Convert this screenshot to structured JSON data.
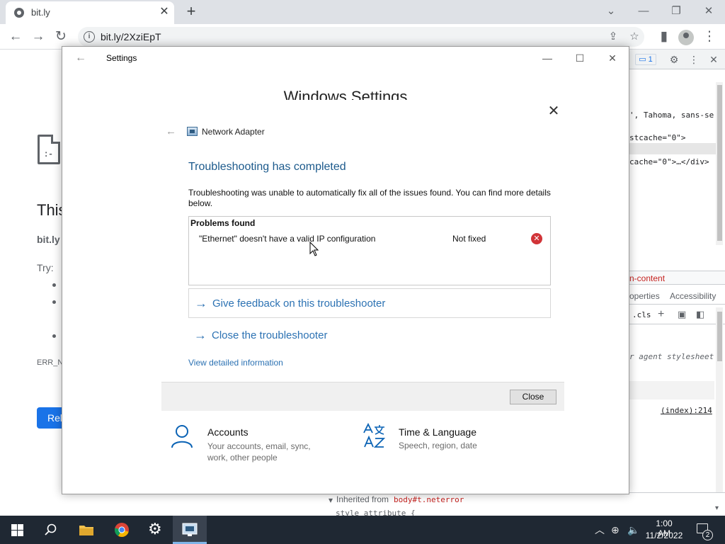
{
  "browser": {
    "tab_title": "bit.ly",
    "url": "bit.ly/2XziEpT",
    "icons": [
      "globe-icon",
      "close-icon",
      "plus-icon",
      "back-icon",
      "forward-icon",
      "reload-icon",
      "info-icon",
      "share-icon",
      "star-icon",
      "sidepanel-icon",
      "profile-icon",
      "menu-icon"
    ]
  },
  "error_page": {
    "title_partial": "This",
    "host_partial": "bit.ly",
    "try_label": "Try:",
    "code_partial": "ERR_NA",
    "reload_partial": "Rel"
  },
  "devtools": {
    "issues_count": "1",
    "code_line_1": "', Tahoma, sans-se",
    "code_line_2": "stcache=\"0\">",
    "code_line_3": "cache=\"0\">…</div>",
    "crumb": "n-content",
    "subtab_properties": "operties",
    "subtab_accessibility": "Accessibility",
    "filter_cls": ".cls",
    "ua_stylesheet": "r agent stylesheet",
    "source_link": "(index):214",
    "inherited_label": "Inherited from",
    "inherited_selector": "body#t.neterror",
    "style_attr": "style attribute {"
  },
  "settings_window": {
    "title": "Settings",
    "heading": "Windows Settings",
    "accounts": {
      "title": "Accounts",
      "desc": "Your accounts, email, sync, work, other people"
    },
    "time_language": {
      "title": "Time & Language",
      "desc": "Speech, region, date"
    }
  },
  "troubleshooter": {
    "breadcrumb": "Network Adapter",
    "heading": "Troubleshooting has completed",
    "description": "Troubleshooting was unable to automatically fix all of the issues found. You can find more details below.",
    "problems_header": "Problems found",
    "problems": [
      {
        "text": "\"Ethernet\" doesn't have a valid IP configuration",
        "status": "Not fixed"
      }
    ],
    "feedback_link": "Give feedback on this troubleshooter",
    "close_ts_link": "Close the troubleshooter",
    "detail_link": "View detailed information",
    "close_button": "Close"
  },
  "taskbar": {
    "time": "1:00 AM",
    "date": "11/2/2022",
    "notification_count": "2"
  },
  "colors": {
    "link_blue": "#2c72b3",
    "heading_blue": "#1c5a8c",
    "error_red": "#d13438",
    "taskbar": "#1f2833",
    "chrome_blue": "#1a73e8"
  }
}
